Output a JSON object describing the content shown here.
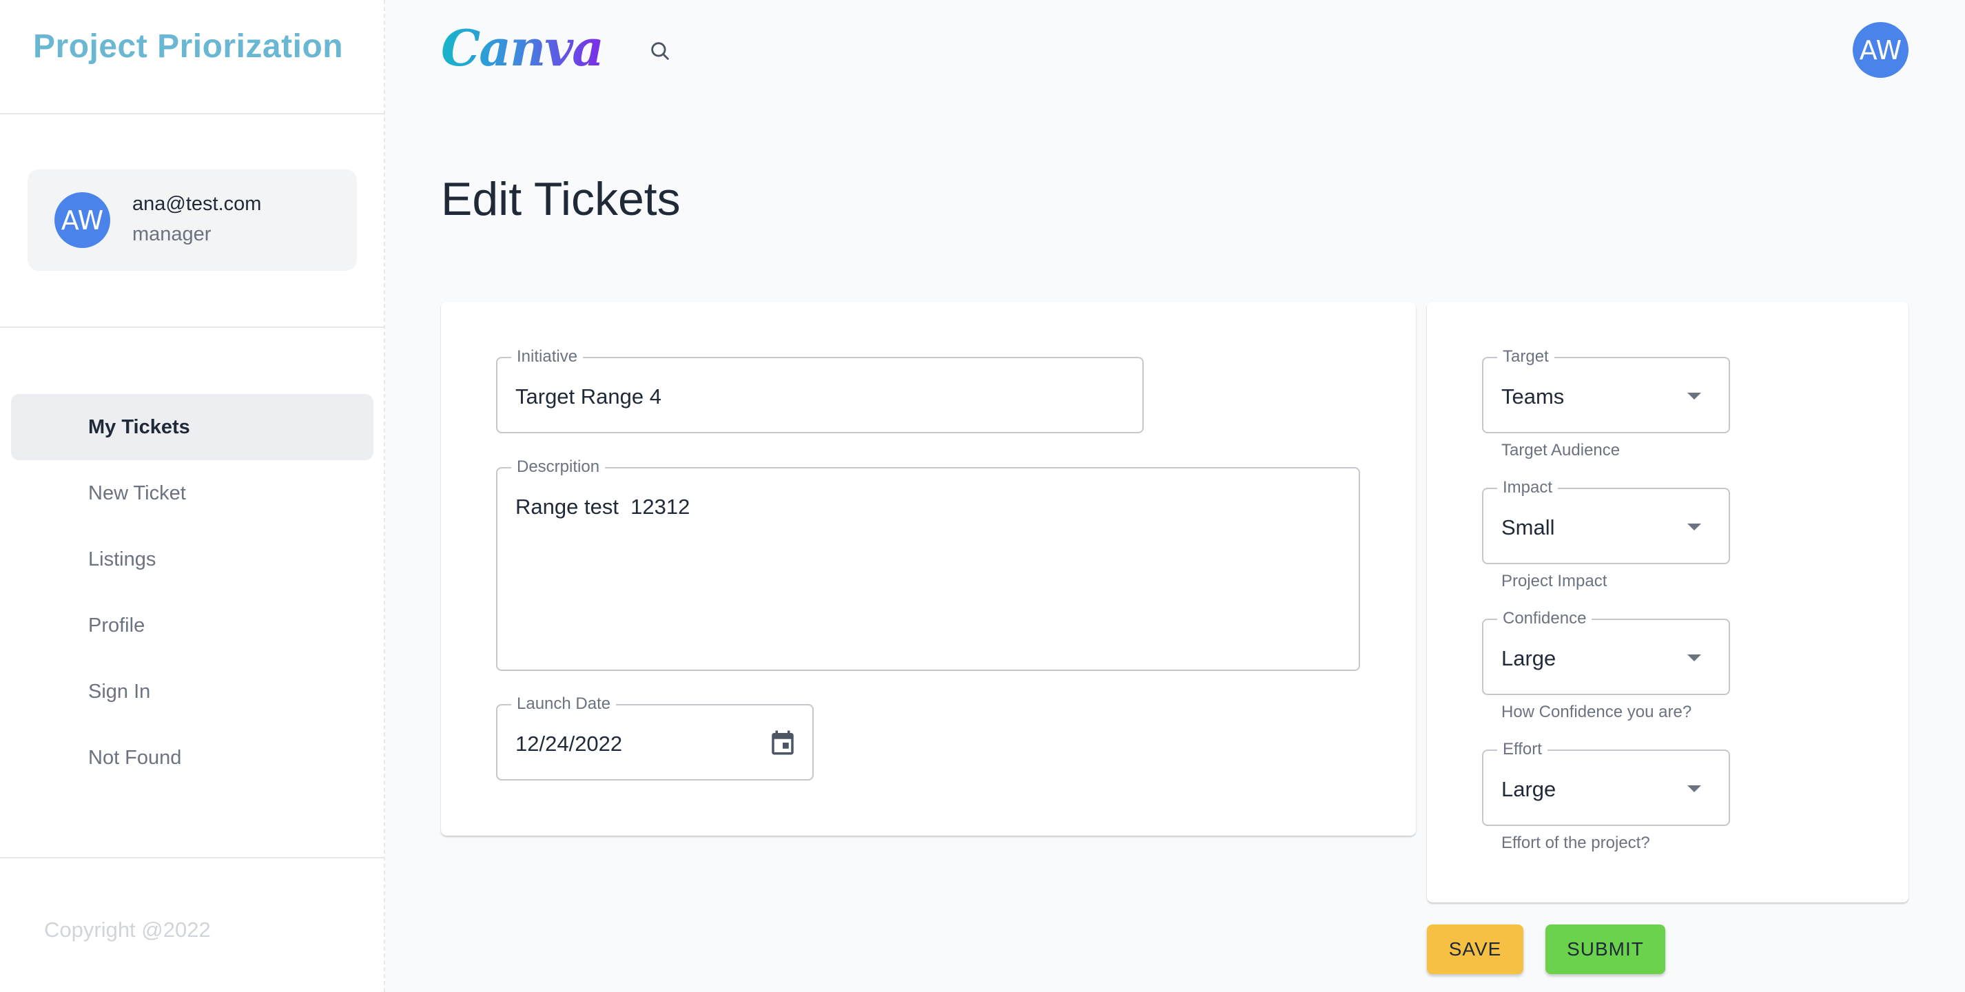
{
  "sidebar": {
    "brand": "Project Priorization",
    "user": {
      "initials": "AW",
      "email": "ana@test.com",
      "role": "manager"
    },
    "nav": [
      {
        "label": "My Tickets",
        "active": true
      },
      {
        "label": "New Ticket"
      },
      {
        "label": "Listings"
      },
      {
        "label": "Profile"
      },
      {
        "label": "Sign In"
      },
      {
        "label": "Not Found"
      }
    ],
    "copyright": "Copyright @2022"
  },
  "header": {
    "logo": "Canva",
    "search_icon": "search-icon",
    "avatar_initials": "AW"
  },
  "page": {
    "title": "Edit Tickets"
  },
  "form": {
    "initiative": {
      "label": "Initiative",
      "value": "Target Range 4"
    },
    "description": {
      "label": "Descrpition",
      "value": "Range test  12312"
    },
    "launch_date": {
      "label": "Launch Date",
      "value": "12/24/2022",
      "icon": "calendar-icon"
    }
  },
  "selects": {
    "target": {
      "label": "Target",
      "value": "Teams",
      "helper": "Target Audience"
    },
    "impact": {
      "label": "Impact",
      "value": "Small",
      "helper": "Project Impact"
    },
    "confidence": {
      "label": "Confidence",
      "value": "Large",
      "helper": "How Confidence you are?"
    },
    "effort": {
      "label": "Effort",
      "value": "Large",
      "helper": "Effort of the project?"
    }
  },
  "actions": {
    "save": "SAVE",
    "submit": "SUBMIT"
  },
  "colors": {
    "brand": "#6ab7d3",
    "avatar": "#4a84ea",
    "save": "#f6c042",
    "submit": "#6bd24c"
  }
}
